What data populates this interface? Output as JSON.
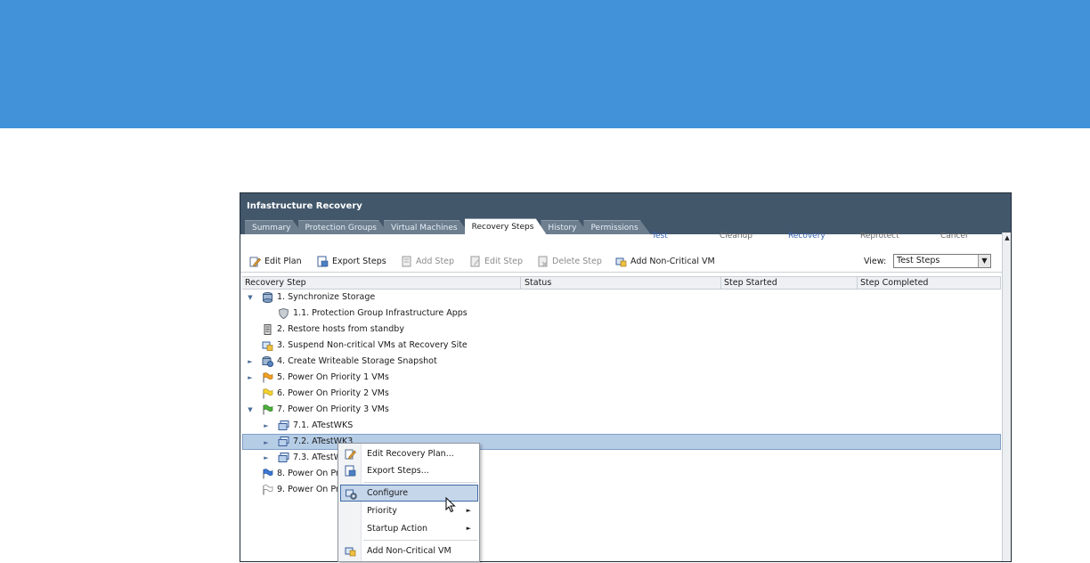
{
  "window": {
    "title": "Infastructure Recovery",
    "tabs": [
      "Summary",
      "Protection Groups",
      "Virtual Machines",
      "Recovery Steps",
      "History",
      "Permissions"
    ],
    "active_tab": "Recovery Steps",
    "ghost_actions": [
      "Test",
      "Cleanup",
      "Recovery",
      "Reprotect",
      "Cancel"
    ]
  },
  "toolbar": {
    "edit_plan": "Edit Plan",
    "export_steps": "Export Steps",
    "add_step": "Add Step",
    "edit_step": "Edit Step",
    "delete_step": "Delete Step",
    "add_noncritical_vm": "Add Non-Critical VM",
    "view_label": "View:",
    "view_value": "Test Steps"
  },
  "columns": [
    "Recovery Step",
    "Status",
    "Step Started",
    "Step Completed"
  ],
  "rows": [
    {
      "label": "1. Synchronize Storage",
      "icon": "storage-sync-icon"
    },
    {
      "label": "1.1. Protection Group Infrastructure Apps",
      "icon": "shield-icon"
    },
    {
      "label": "2. Restore hosts from standby",
      "icon": "host-icon"
    },
    {
      "label": "3. Suspend Non-critical VMs at Recovery Site",
      "icon": "vm-suspend-icon"
    },
    {
      "label": "4. Create Writeable Storage Snapshot",
      "icon": "snapshot-icon"
    },
    {
      "label": "5. Power On Priority 1 VMs",
      "icon": "flag-orange-icon"
    },
    {
      "label": "6. Power On Priority 2 VMs",
      "icon": "flag-yellow-icon"
    },
    {
      "label": "7. Power On Priority 3 VMs",
      "icon": "flag-green-icon"
    },
    {
      "label": "7.1. ATestWKS",
      "icon": "vm-icon"
    },
    {
      "label": "7.2. ATestWK3",
      "icon": "vm-icon"
    },
    {
      "label": "7.3. ATestW",
      "icon": "vm-icon"
    },
    {
      "label": "8. Power On Pri",
      "icon": "flag-blue-icon"
    },
    {
      "label": "9. Power On Pri",
      "icon": "flag-white-icon"
    }
  ],
  "context_menu": {
    "edit_plan": "Edit Recovery Plan...",
    "export_steps": "Export Steps...",
    "configure": "Configure",
    "priority": "Priority",
    "startup_action": "Startup Action",
    "add_noncritical_vm": "Add Non-Critical VM"
  },
  "colors": {
    "banner": "#4192d9",
    "titlebar": "#43576b",
    "selection": "#b6cde6"
  }
}
